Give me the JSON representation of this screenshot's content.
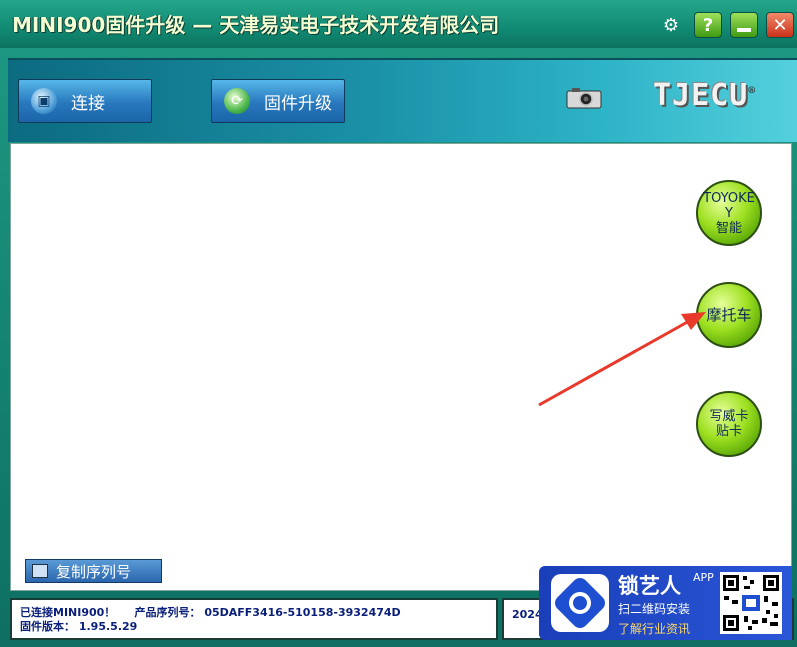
{
  "window": {
    "title": "MINI900固件升级 — 天津易实电子技术开发有限公司"
  },
  "titlebar": {
    "gear_icon": "⚙",
    "help_label": "?",
    "close_label": "✕"
  },
  "toolbar": {
    "connect_label": "连接",
    "upgrade_label": "固件升级",
    "logo_text": "TJECU",
    "logo_mark": "®"
  },
  "side_buttons": {
    "toyokey_line1": "TOYOKE",
    "toyokey_line2": "Y",
    "toyokey_line3": "智能",
    "moto": "摩托车",
    "weika_line1": "写威卡",
    "weika_line2": "贴卡"
  },
  "copy_serial_label": "复制序列号",
  "status": {
    "connected": "已连接MINI900！",
    "serial_label": "产品序列号：",
    "serial_value": "05DAFF3416-510158-3932474D",
    "version_label": "固件版本：",
    "version_value": "1.95.5.29",
    "right_partial": "2024"
  },
  "watermark": {
    "brand": "锁艺人",
    "app": "APP",
    "line1": "扫二维码安装",
    "line2": "了解行业资讯"
  },
  "colors": {
    "title_text": "#f3ffd2",
    "status_text": "#0a1f7a",
    "round_green": "#9ee021",
    "arrow_red": "#e8392a"
  }
}
